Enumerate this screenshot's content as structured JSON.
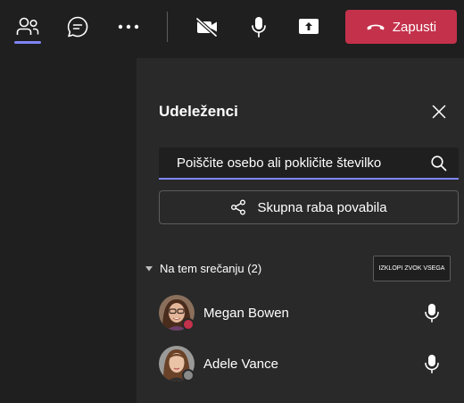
{
  "toolbar": {
    "items": [
      {
        "id": "people",
        "icon": "people-icon"
      },
      {
        "id": "chat",
        "icon": "chat-icon"
      },
      {
        "id": "more",
        "icon": "more-icon"
      },
      {
        "id": "camera",
        "icon": "camera-off-icon"
      },
      {
        "id": "mic",
        "icon": "microphone-icon"
      },
      {
        "id": "share",
        "icon": "share-screen-icon"
      }
    ],
    "leave_label": "Zapusti",
    "leave_color": "#c4314b",
    "accent_color": "#7f85f5"
  },
  "panel": {
    "title": "Udeleženci",
    "search_placeholder": "Poiščite osebo ali pokličite številko",
    "share_invite_label": "Skupna raba povabila",
    "section_label": "Na tem srečanju (2)",
    "mute_all_label": "IZKLOPI ZVOK VSEGA",
    "participants": [
      {
        "name": "Megan Bowen",
        "status": "busy",
        "status_color": "#c4314b"
      },
      {
        "name": "Adele Vance",
        "status": "offline",
        "status_color": "#8a8a8a"
      }
    ]
  }
}
